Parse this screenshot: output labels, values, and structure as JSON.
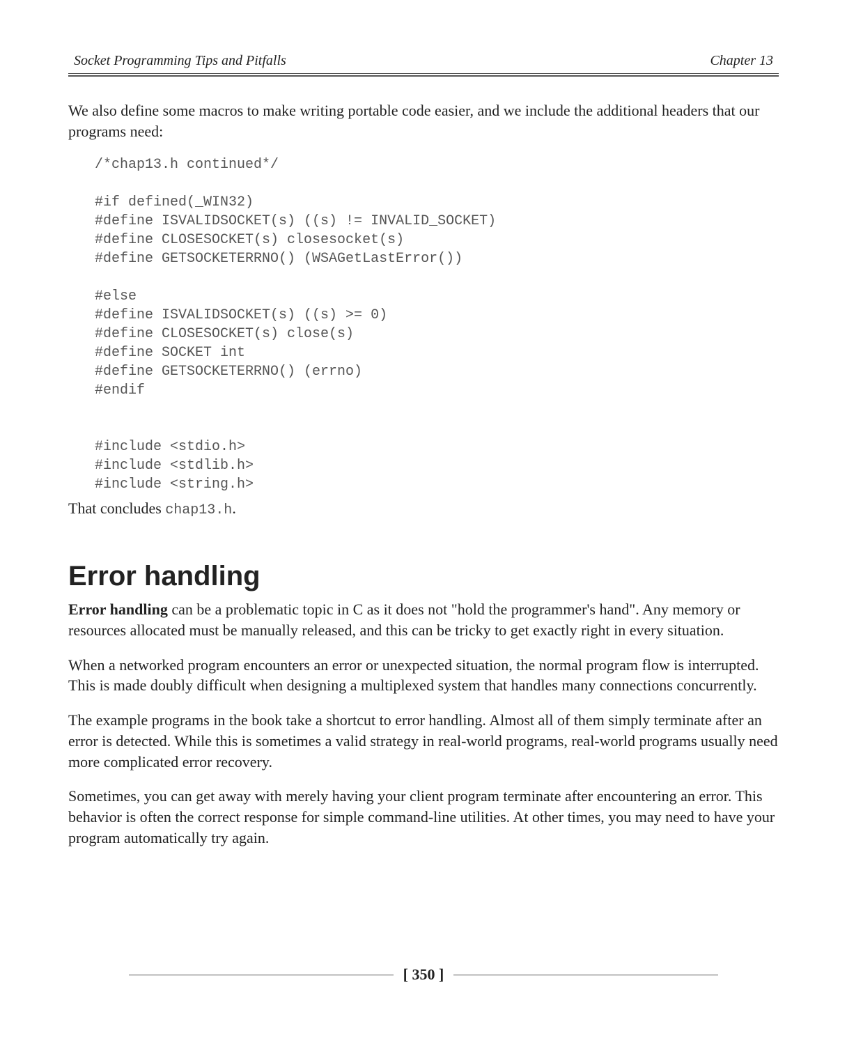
{
  "header": {
    "left": "Socket Programming Tips and Pitfalls",
    "right": "Chapter 13"
  },
  "intro_para": "We also define some macros to make writing portable code easier, and we include the additional headers that our programs need:",
  "code_lines": [
    "/*chap13.h continued*/",
    "",
    "#if defined(_WIN32)",
    "#define ISVALIDSOCKET(s) ((s) != INVALID_SOCKET)",
    "#define CLOSESOCKET(s) closesocket(s)",
    "#define GETSOCKETERRNO() (WSAGetLastError())",
    "",
    "#else",
    "#define ISVALIDSOCKET(s) ((s) >= 0)",
    "#define CLOSESOCKET(s) close(s)",
    "#define SOCKET int",
    "#define GETSOCKETERRNO() (errno)",
    "#endif",
    "",
    "",
    "#include <stdio.h>",
    "#include <stdlib.h>",
    "#include <string.h>"
  ],
  "conclude": {
    "prefix": "That concludes ",
    "code": "chap13.h",
    "suffix": "."
  },
  "section_heading": "Error handling",
  "paras": {
    "p1_bold": "Error handling",
    "p1_rest": " can be a problematic topic in C as it does not \"hold the programmer's hand\". Any memory or resources allocated must be manually released, and this can be tricky to get exactly right in every situation.",
    "p2": "When a networked program encounters an error or unexpected situation, the normal program flow is interrupted. This is made doubly difficult when designing a multiplexed system that handles many connections concurrently.",
    "p3": "The example programs in the book take a shortcut to error handling. Almost all of them simply terminate after an error is detected. While this is sometimes a valid strategy in real-world programs, real-world programs usually need more complicated error recovery.",
    "p4": "Sometimes, you can get away with merely having your client program terminate after encountering an error. This behavior is often the correct response for simple command-line utilities. At other times, you may need to have your program automatically try again."
  },
  "page_number": "[ 350 ]"
}
